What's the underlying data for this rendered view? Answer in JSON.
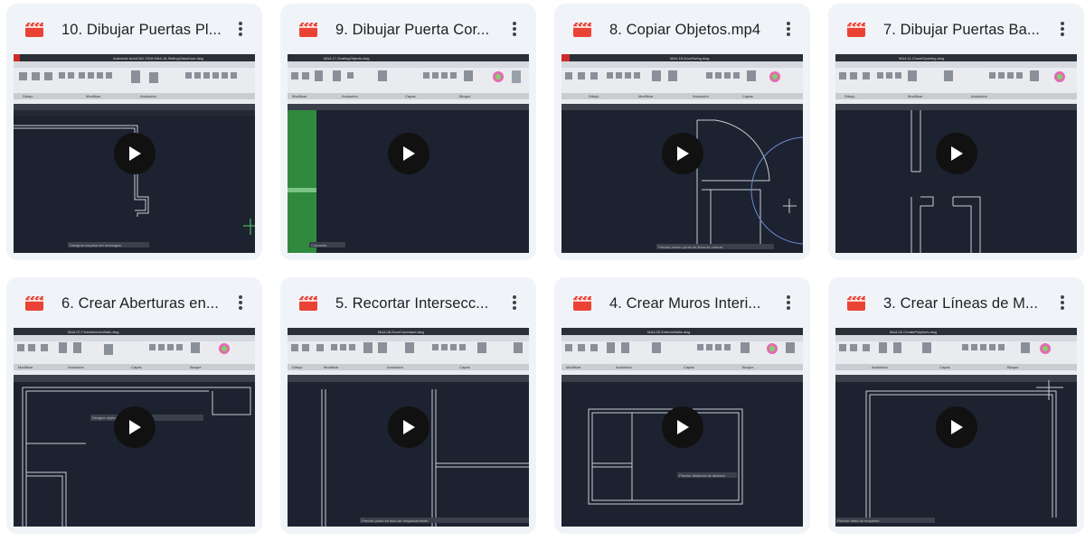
{
  "cards": [
    {
      "title": "10. Dibujar Puertas Pl...",
      "icon": "video-file-icon",
      "tab": "Autodesk AutoCAD 2018   MA4-18-SlidingGlassDoor.dwg",
      "status": "Designar esquina del rectangulo"
    },
    {
      "title": "9. Dibujar Puerta Cor...",
      "icon": "video-file-icon",
      "tab": "MA4-17-ScalingObjects.dwg",
      "status": "Comando"
    },
    {
      "title": "8. Copiar Objetos.mp4",
      "icon": "video-file-icon",
      "tab": "MA4-16-DoorSwing.dwg",
      "status": "Precise primer punto de linea de cuerda"
    },
    {
      "title": "7. Dibujar Puertas Ba...",
      "icon": "video-file-icon",
      "tab": "MA4-11-ClosetOpening.dwg",
      "status": ""
    },
    {
      "title": "6. Crear Aberturas en...",
      "icon": "video-file-icon",
      "tab": "MA4-07-FinishInteriorWalls.dwg",
      "status": "Designe objetos a alargar"
    },
    {
      "title": "5. Recortar Intersecc...",
      "icon": "video-file-icon",
      "tab": "MA4-06-DoorCommand.dwg",
      "status": "Precise punto en lado de desplazamiento"
    },
    {
      "title": "4. Crear Muros Interi...",
      "icon": "video-file-icon",
      "tab": "MA4-05-ExteriorWalls.dwg",
      "status": "Precise distancia de desfase"
    },
    {
      "title": "3. Crear Líneas de M...",
      "icon": "video-file-icon",
      "tab": "MA4-02-CreatePolylines.dwg",
      "status": "Precise radio de empalme"
    }
  ],
  "ribbon_labels": [
    "Dibujo",
    "Modificar",
    "Anotación",
    "Capas",
    "Bloque"
  ],
  "colors": {
    "card_bg": "#f0f4f9",
    "video_icon": "#ea4335",
    "cad_bg": "#1d2230",
    "ribbon_bg": "#e9ebee"
  }
}
